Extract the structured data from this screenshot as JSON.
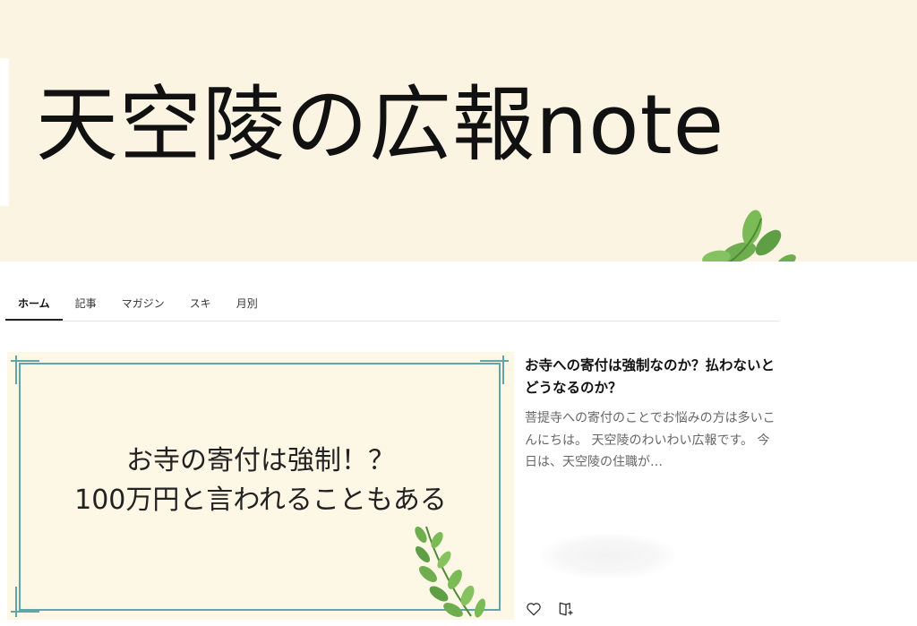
{
  "header": {
    "banner_title": "天空陵の広報note"
  },
  "tabs": [
    {
      "label": "ホーム",
      "active": true
    },
    {
      "label": "記事",
      "active": false
    },
    {
      "label": "マガジン",
      "active": false
    },
    {
      "label": "スキ",
      "active": false
    },
    {
      "label": "月別",
      "active": false
    }
  ],
  "article": {
    "thumbnail_line1": "お寺の寄付は強制！？",
    "thumbnail_line2": "100万円と言われることもある",
    "title": "お寺への寄付は強制なのか？払わないとどうなるのか？",
    "excerpt": "菩提寺への寄付のことでお悩みの方は多いこんにちは。 天空陵のわいわい広報です。 今日は、天空陵の住職が…"
  },
  "icons": {
    "like": "heart-icon",
    "save": "bookmark-icon"
  },
  "colors": {
    "banner_bg": "#fbf4e3",
    "frame": "#5fa6a6",
    "leaf": "#6fae4f"
  }
}
